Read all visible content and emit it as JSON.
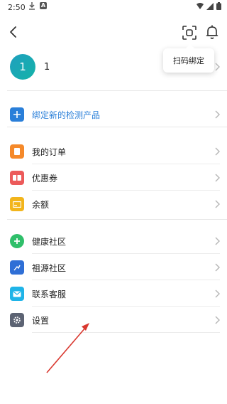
{
  "status_bar": {
    "time": "2:50"
  },
  "tooltip": {
    "label": "扫码绑定"
  },
  "profile": {
    "avatar_text": "1",
    "name": "1"
  },
  "bind_product": {
    "label": "绑定新的检测产品",
    "color": "#2a7fd9"
  },
  "menu_group_1": [
    {
      "label": "我的订单",
      "icon": "order-icon",
      "color": "#f5892a"
    },
    {
      "label": "优惠券",
      "icon": "coupon-icon",
      "color": "#ec5a5a"
    },
    {
      "label": "余额",
      "icon": "balance-icon",
      "color": "#f2b51c"
    }
  ],
  "menu_group_2": [
    {
      "label": "健康社区",
      "icon": "health-community-icon",
      "color": "#2fbf6a"
    },
    {
      "label": "祖源社区",
      "icon": "ancestry-community-icon",
      "color": "#2f6fd6"
    },
    {
      "label": "联系客服",
      "icon": "contact-service-icon",
      "color": "#1fb4e8"
    },
    {
      "label": "设置",
      "icon": "settings-icon",
      "color": "#5c6373"
    }
  ]
}
